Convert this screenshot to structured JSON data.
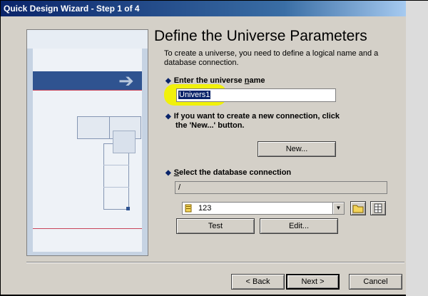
{
  "window": {
    "title": "Quick Design Wizard - Step 1 of 4"
  },
  "main": {
    "heading": "Define the Universe Parameters",
    "description": "To create a universe, you need to define a logical name and a database connection.",
    "universe_name": {
      "pre": "Enter the universe ",
      "accel": "n",
      "post": "ame",
      "value": "Univers1"
    },
    "new_connection_instruction": {
      "line1": "If you want to create a new connection, click",
      "line2": "the 'New...' button."
    },
    "new_button": "New...",
    "select_connection": {
      "accel": "S",
      "rest": "elect the database connection"
    },
    "connection_path": "/",
    "connection_selected": "123",
    "test_button": "Test",
    "edit_button": "Edit..."
  },
  "footer": {
    "back_button": "< Back",
    "next_button": "Next >",
    "cancel_button": "Cancel"
  },
  "icons": {
    "folder": "folder-icon",
    "table": "table-icon",
    "database": "database-icon",
    "arrow": "arrow-right-icon",
    "dropdown": "chevron-down-icon"
  },
  "colors": {
    "titlebar": "#0a246a",
    "panel_bar": "#2f5390",
    "highlight": "#f2f200"
  }
}
